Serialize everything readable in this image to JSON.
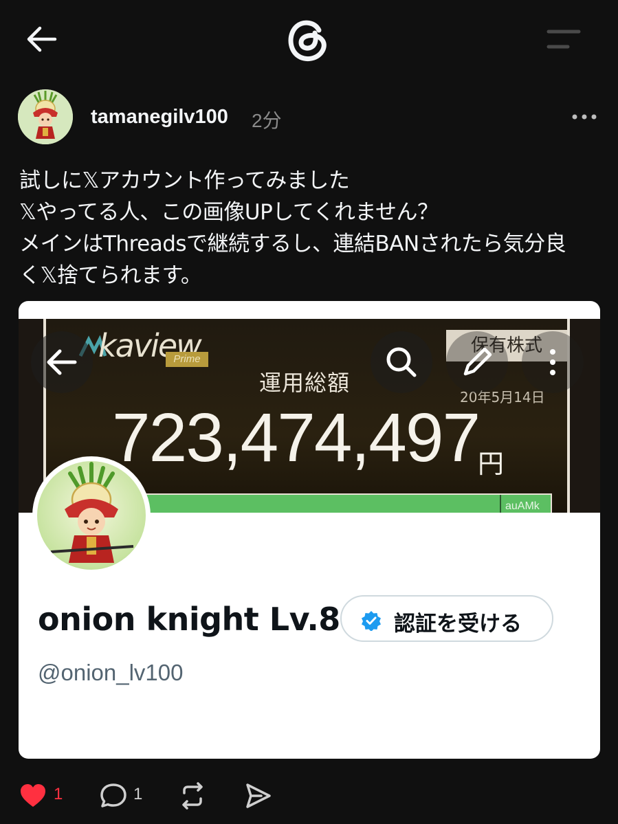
{
  "header": {
    "back_icon": "arrow-left-icon",
    "logo_icon": "threads-logo-icon",
    "menu_icon": "menu-lines-icon"
  },
  "post": {
    "username": "tamanegilv100",
    "timestamp": "2分",
    "more_icon": "more-horizontal-icon",
    "text_lines": [
      "試しに𝕏アカウント作ってみました",
      "𝕏やってる人、この画像UPしてくれません？",
      "メインはThreadsで継続するし、連結BANされたら気分良",
      "く𝕏捨てられます。"
    ]
  },
  "media": {
    "banner": {
      "app_name": "kaview",
      "app_badge": "Prime",
      "holdings_label": "保有株式",
      "label": "運用総額",
      "date": "20年5月14日",
      "amount": "723,474,497",
      "currency": "円",
      "bar_label": "auAMk"
    },
    "profile": {
      "display_name": "onion knight Lv.8",
      "verify_label": "認証を受ける",
      "handle": "@onion_lv100"
    }
  },
  "actions": {
    "like_count": "1",
    "reply_count": "1",
    "colors": {
      "like": "#ff3040"
    }
  }
}
